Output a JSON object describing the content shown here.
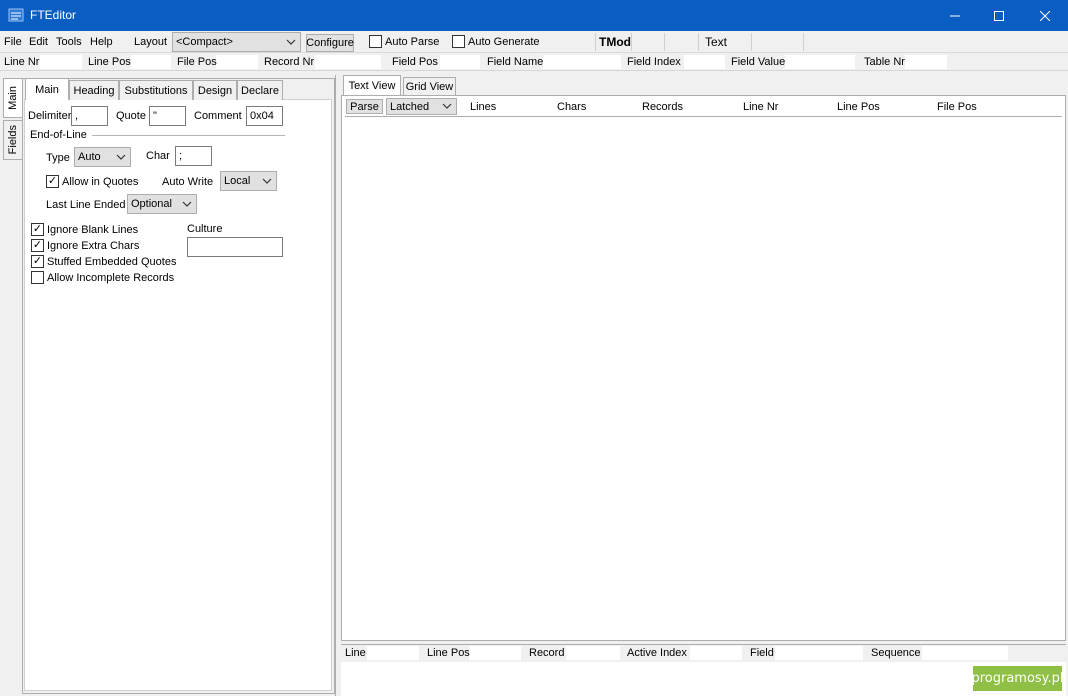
{
  "app": {
    "title": "FTEditor"
  },
  "window_controls": {
    "minimize": "—",
    "maximize": "☐",
    "close": "✕"
  },
  "menu": [
    "File",
    "Edit",
    "Tools",
    "Help"
  ],
  "toolbar": {
    "layout_label": "Layout",
    "layout_value": "<Compact>",
    "configure_label": "Configure",
    "auto_parse_label": "Auto Parse",
    "auto_parse_checked": false,
    "auto_generate_label": "Auto Generate",
    "auto_generate_checked": false,
    "tmode_label": "TMod",
    "text_label": "Text"
  },
  "status_header": [
    "Line Nr",
    "Line Pos",
    "File Pos",
    "Record Nr",
    "Field Pos",
    "Field Name",
    "Field Index",
    "Field Value",
    "Table Nr"
  ],
  "side_tabs": [
    "Main",
    "Fields"
  ],
  "left_tabs": [
    "Main",
    "Heading",
    "Substitutions",
    "Design",
    "Declare"
  ],
  "main_settings": {
    "delimiter_label": "Delimiter",
    "delimiter_value": ",",
    "quote_label": "Quote",
    "quote_value": "\"",
    "comment_label": "Comment",
    "comment_value": "0x04",
    "eol_group_label": "End-of-Line",
    "type_label": "Type",
    "type_value": "Auto",
    "char_label": "Char",
    "char_value": ";",
    "allow_in_quotes_label": "Allow in Quotes",
    "allow_in_quotes_checked": true,
    "auto_write_label": "Auto Write",
    "auto_write_value": "Local",
    "last_line_ended_label": "Last Line Ended",
    "last_line_ended_value": "Optional",
    "ignore_blank_lines_label": "Ignore Blank Lines",
    "ignore_blank_lines_checked": true,
    "ignore_extra_chars_label": "Ignore Extra Chars",
    "ignore_extra_chars_checked": true,
    "stuffed_quotes_label": "Stuffed Embedded Quotes",
    "stuffed_quotes_checked": true,
    "allow_incomplete_label": "Allow Incomplete Records",
    "allow_incomplete_checked": false,
    "culture_label": "Culture",
    "culture_value": ""
  },
  "right_tabs": [
    "Text View",
    "Grid View"
  ],
  "text_view": {
    "parse_label": "Parse",
    "latched_value": "Latched",
    "columns": [
      "Lines",
      "Chars",
      "Records",
      "Line Nr",
      "Line Pos",
      "File Pos"
    ]
  },
  "bottom_status": [
    "Line",
    "Line Pos",
    "Record",
    "Active Index",
    "Field",
    "Sequence"
  ],
  "watermark": "programosy.pl",
  "icons": {
    "checkmark": "✓",
    "chevron": "⌄"
  }
}
